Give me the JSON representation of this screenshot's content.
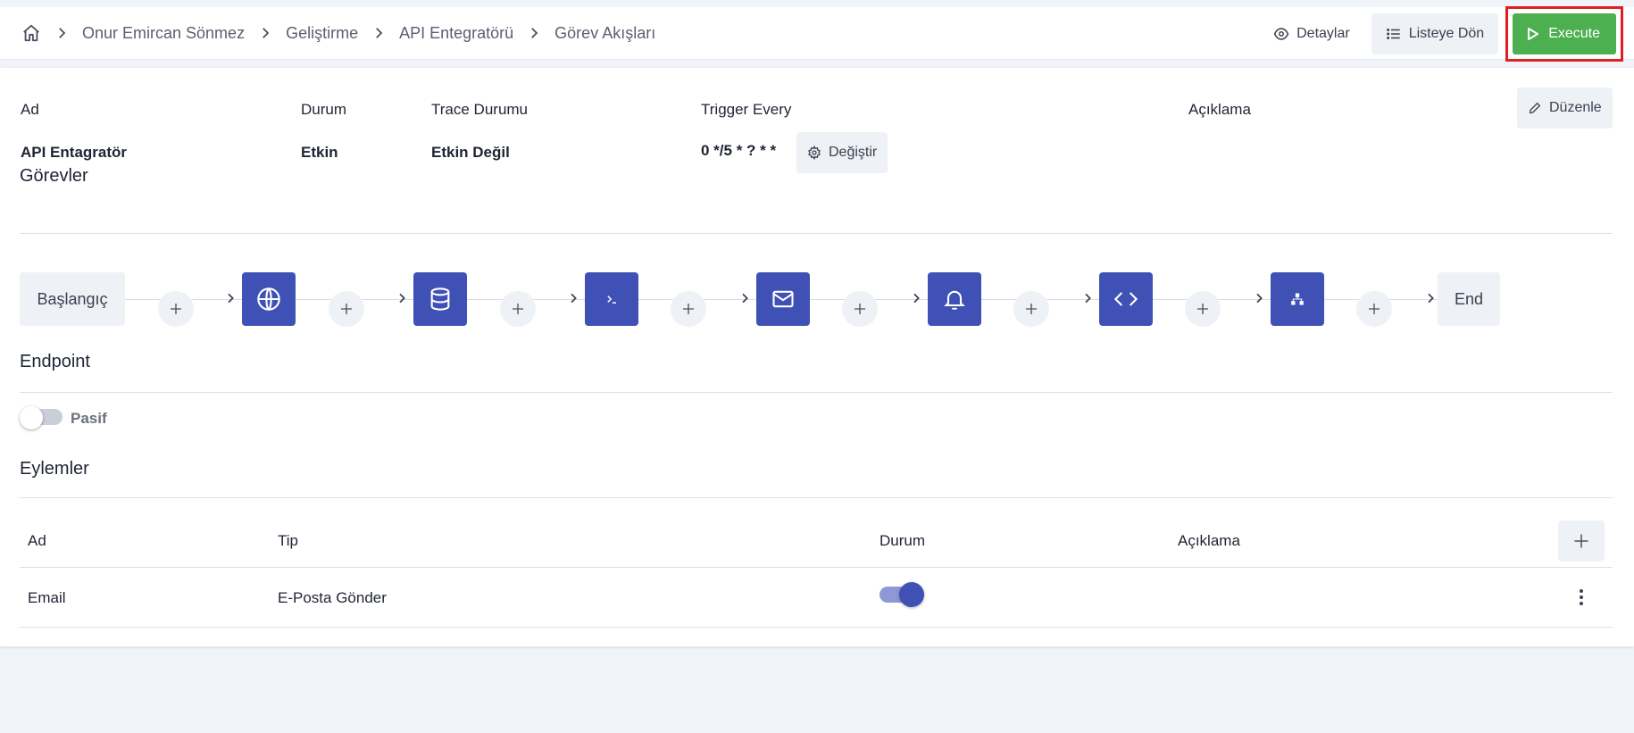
{
  "breadcrumb": {
    "items": [
      "Onur Emircan Sönmez",
      "Geliştirme",
      "API Entegratörü",
      "Görev Akışları"
    ]
  },
  "header_actions": {
    "details_label": "Detaylar",
    "back_label": "Listeye Dön",
    "execute_label": "Execute"
  },
  "summary": {
    "labels": {
      "name": "Ad",
      "status": "Durum",
      "trace": "Trace Durumu",
      "trigger": "Trigger Every",
      "description": "Açıklama"
    },
    "values": {
      "name": "API Entagratör",
      "status": "Etkin",
      "trace": "Etkin Değil",
      "trigger": "0 */5 * ? * *",
      "description": ""
    },
    "edit_label": "Düzenle",
    "change_label": "Değiştir"
  },
  "tasks": {
    "title": "Görevler",
    "start_label": "Başlangıç",
    "end_label": "End",
    "nodes": [
      "globe-icon",
      "database-icon",
      "terminal-icon",
      "mail-icon",
      "bell-icon",
      "code-icon",
      "sitemap-icon"
    ]
  },
  "endpoint": {
    "title": "Endpoint",
    "toggle_label": "Pasif",
    "enabled": false
  },
  "actions": {
    "title": "Eylemler",
    "columns": [
      "Ad",
      "Tip",
      "Durum",
      "Açıklama"
    ],
    "rows": [
      {
        "name": "Email",
        "type": "E-Posta Gönder",
        "enabled": true,
        "description": ""
      }
    ]
  },
  "colors": {
    "primary": "#3f51b5",
    "execute": "#4caf50",
    "highlight": "#e02020",
    "soft": "#eef1f6"
  }
}
